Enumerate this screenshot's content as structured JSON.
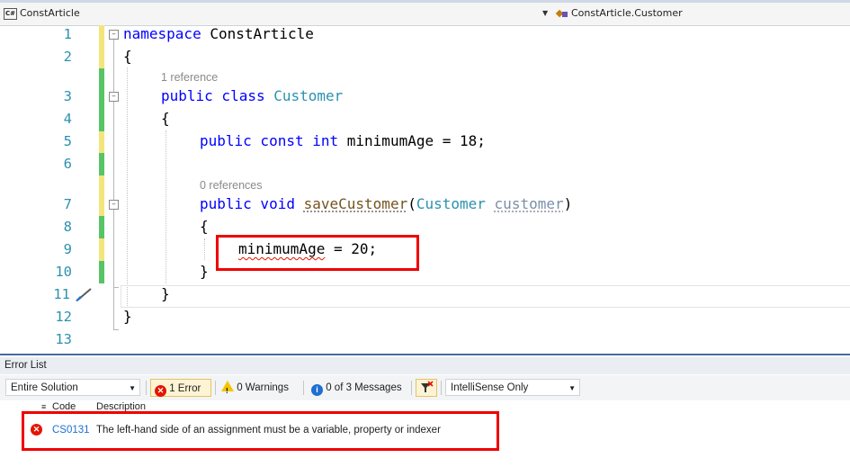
{
  "navbar": {
    "project": "ConstArticle",
    "project_icon": "C#",
    "member": "ConstArticle.Customer"
  },
  "editor": {
    "line_numbers": [
      "1",
      "2",
      "3",
      "4",
      "5",
      "6",
      "7",
      "8",
      "9",
      "10",
      "11",
      "12",
      "13"
    ],
    "code": {
      "l1_kw": "namespace",
      "l1_name": " ConstArticle",
      "l2": "{",
      "lens_class": "1 reference",
      "l3_kw": "public class",
      "l3_type": "Customer",
      "l4": "{",
      "l5_kw1": "public const",
      "l5_kw2": "int",
      "l5_rest": " minimumAge = 18;",
      "lens_method": "0 references",
      "l7_kw": "public void",
      "l7_method": "saveCustomer",
      "l7_open": "(",
      "l7_type": "Customer",
      "l7_param": "customer",
      "l7_close": ")",
      "l8": "{",
      "l9_target": "minimumAge",
      "l9_rest": " = 20;",
      "l10": "}",
      "l11": "}",
      "l12": "}"
    }
  },
  "error_list": {
    "title": "Error List",
    "scope": "Entire Solution",
    "errors_filter": "1 Error",
    "warnings_filter": "0 Warnings",
    "messages_filter": "0 of 3 Messages",
    "build_filter": "IntelliSense Only",
    "col_code": "Code",
    "col_description": "Description",
    "errors": [
      {
        "code": "CS0131",
        "description": "The left-hand side of an assignment must be a variable, property or indexer"
      }
    ]
  },
  "colors": {
    "keyword": "#0000ff",
    "type": "#2b91af",
    "error": "#e51400",
    "highlight_box": "#ee0000"
  }
}
